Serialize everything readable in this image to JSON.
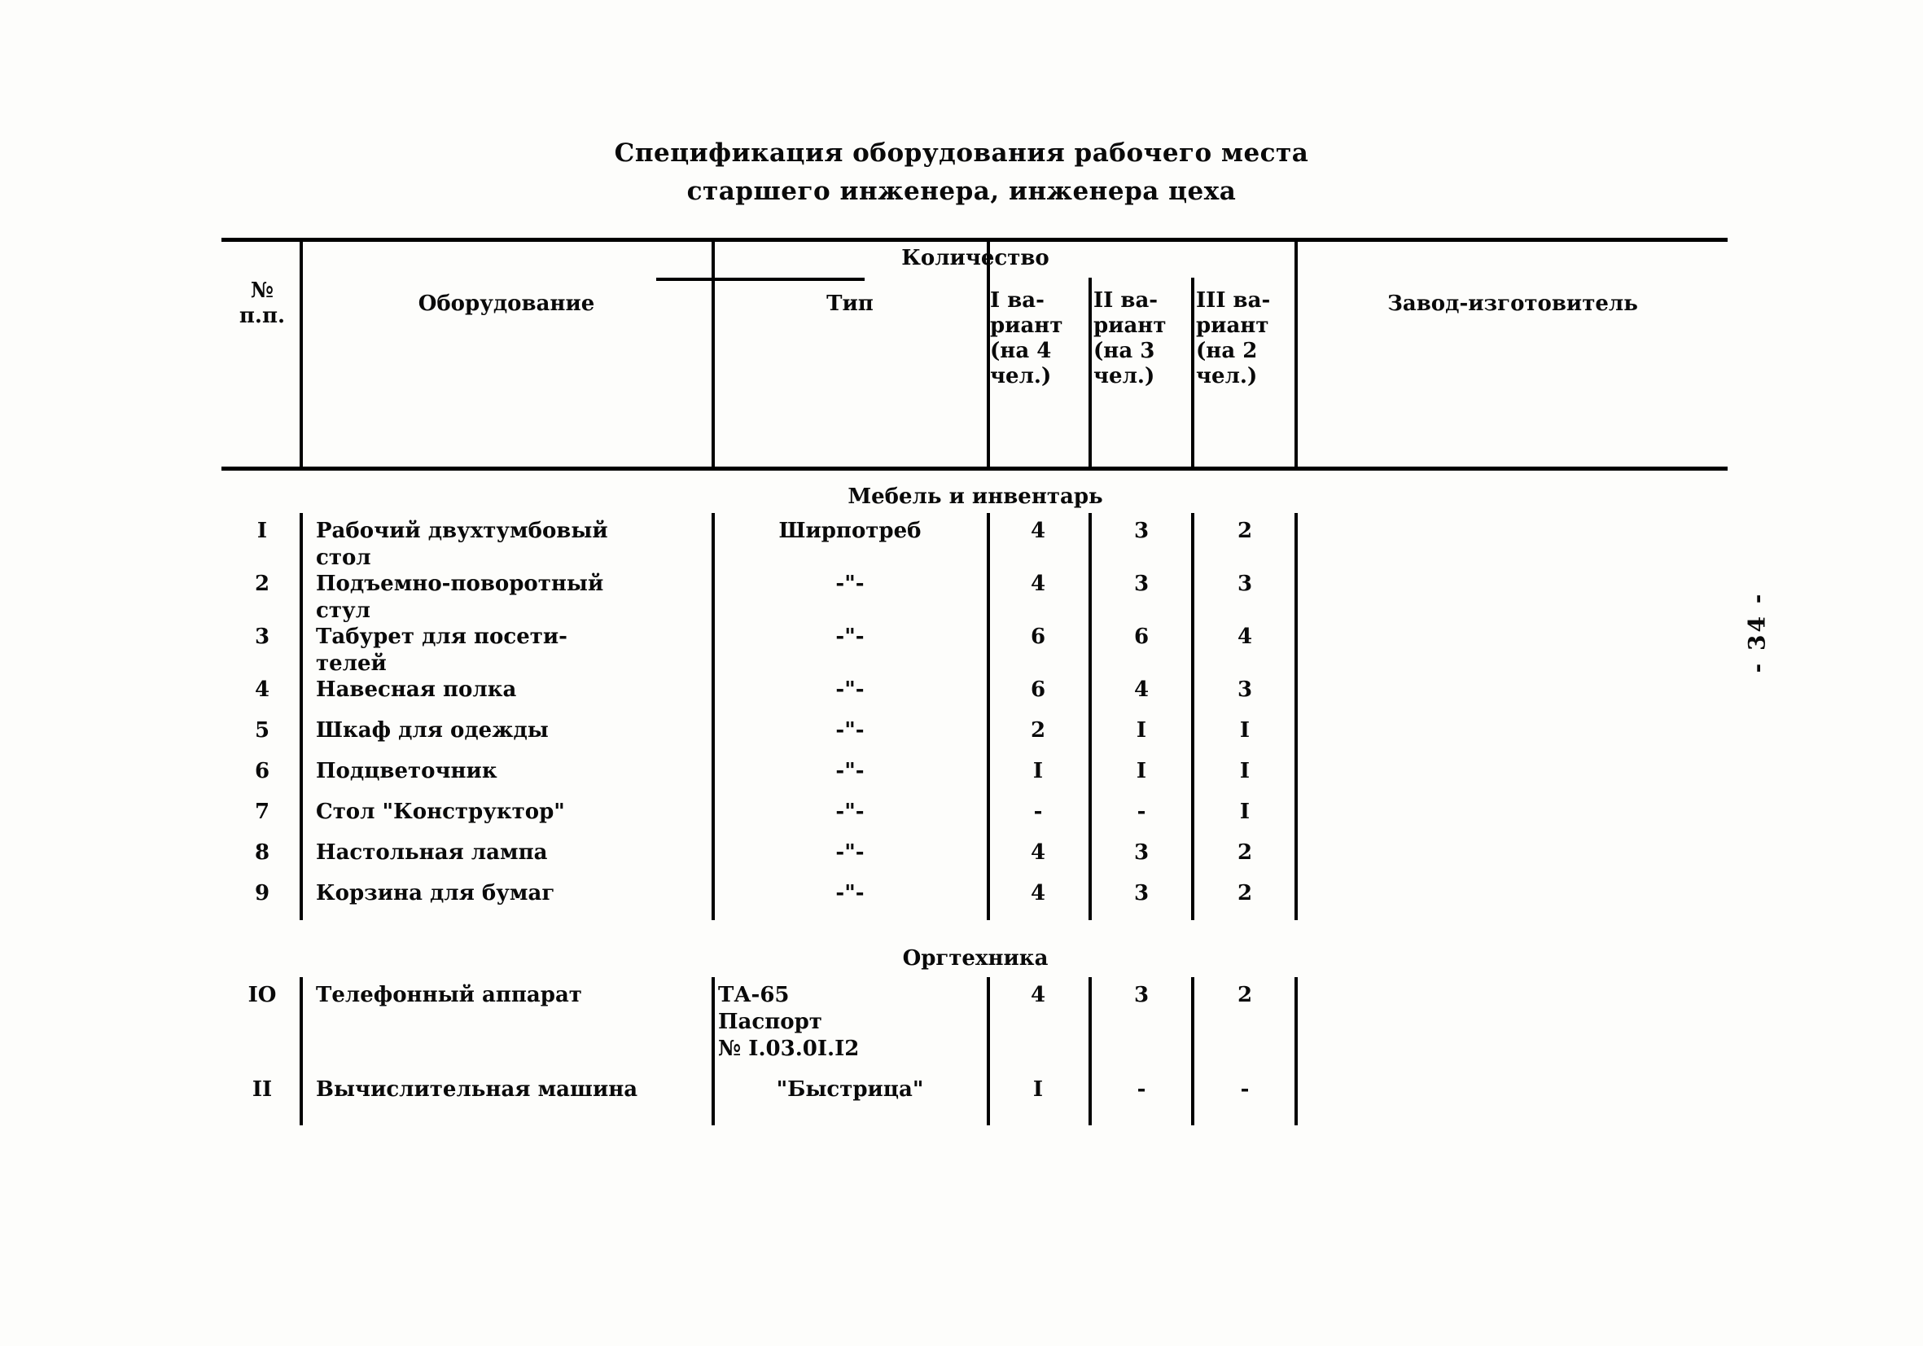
{
  "document": {
    "title_line1": "Спецификация оборудования рабочего места",
    "title_line2": "старшего инженера, инженера цеха",
    "page_number": "- 34 -"
  },
  "table": {
    "headers": {
      "no": "№\nп.п.",
      "equipment": "Оборудование",
      "type": "Тип",
      "quantity_group": "Количество",
      "variant1": "I ва-\nриант\n(на 4\nчел.)",
      "variant2": "II ва-\nриант\n(на 3\nчел.)",
      "variant3": "III ва-\nриант\n(на 2\nчел.)",
      "manufacturer": "Завод-изготовитель"
    },
    "sections": [
      {
        "label": "Мебель и инвентарь",
        "rows": [
          {
            "no": "I",
            "equipment": "Рабочий двухтумбовый\nстол",
            "type": "Ширпотреб",
            "v1": "4",
            "v2": "3",
            "v3": "2",
            "manufacturer": ""
          },
          {
            "no": "2",
            "equipment": "Подъемно-поворотный\nстул",
            "type": "-\"-",
            "v1": "4",
            "v2": "3",
            "v3": "3",
            "manufacturer": ""
          },
          {
            "no": "3",
            "equipment": "Табурет для посети-\nтелей",
            "type": "-\"-",
            "v1": "6",
            "v2": "6",
            "v3": "4",
            "manufacturer": ""
          },
          {
            "no": "4",
            "equipment": "Навесная полка",
            "type": "-\"-",
            "v1": "6",
            "v2": "4",
            "v3": "3",
            "manufacturer": ""
          },
          {
            "no": "5",
            "equipment": "Шкаф для одежды",
            "type": "-\"-",
            "v1": "2",
            "v2": "I",
            "v3": "I",
            "manufacturer": ""
          },
          {
            "no": "6",
            "equipment": "Подцветочник",
            "type": "-\"-",
            "v1": "I",
            "v2": "I",
            "v3": "I",
            "manufacturer": ""
          },
          {
            "no": "7",
            "equipment": "Стол \"Конструктор\"",
            "type": "-\"-",
            "v1": "-",
            "v2": "-",
            "v3": "I",
            "manufacturer": ""
          },
          {
            "no": "8",
            "equipment": "Настольная лампа",
            "type": "-\"-",
            "v1": "4",
            "v2": "3",
            "v3": "2",
            "manufacturer": ""
          },
          {
            "no": "9",
            "equipment": "Корзина для бумаг",
            "type": "-\"-",
            "v1": "4",
            "v2": "3",
            "v3": "2",
            "manufacturer": ""
          }
        ]
      },
      {
        "label": "Оргтехника",
        "rows": [
          {
            "no": "IO",
            "equipment": "Телефонный аппарат",
            "type": "ТА-65\nПаспорт\n№ I.03.0I.I2",
            "v1": "4",
            "v2": "3",
            "v3": "2",
            "manufacturer": ""
          },
          {
            "no": "II",
            "equipment": "Вычислительная машина",
            "type": "\"Быстрица\"",
            "v1": "I",
            "v2": "-",
            "v3": "-",
            "manufacturer": ""
          }
        ]
      }
    ]
  }
}
